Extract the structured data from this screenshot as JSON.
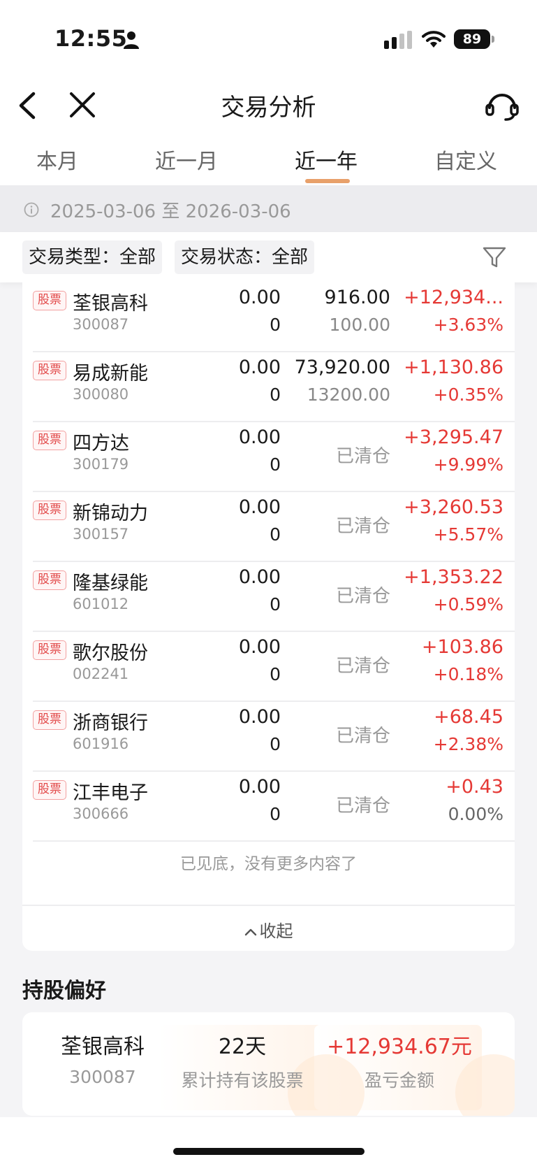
{
  "status_bar": {
    "time": "12:55",
    "battery": "89"
  },
  "nav": {
    "title": "交易分析"
  },
  "tabs": [
    {
      "label": "本月"
    },
    {
      "label": "近一月"
    },
    {
      "label": "近一年"
    },
    {
      "label": "自定义"
    }
  ],
  "active_tab": 2,
  "date_range": "2025-03-06 至 2026-03-06",
  "filters": {
    "type": "交易类型：全部",
    "status": "交易状态：全部"
  },
  "badge_label": "股票",
  "stocks": [
    {
      "name": "荃银高科",
      "code": "300087",
      "a1": "0.00",
      "a2": "0",
      "b1": "916.00",
      "b2": "100.00",
      "c1": "+12,934...",
      "c2": "+3.63%"
    },
    {
      "name": "易成新能",
      "code": "300080",
      "a1": "0.00",
      "a2": "0",
      "b1": "73,920.00",
      "b2": "13200.00",
      "c1": "+1,130.86",
      "c2": "+0.35%"
    },
    {
      "name": "四方达",
      "code": "300179",
      "a1": "0.00",
      "a2": "0",
      "cleared": "已清仓",
      "c1": "+3,295.47",
      "c2": "+9.99%"
    },
    {
      "name": "新锦动力",
      "code": "300157",
      "a1": "0.00",
      "a2": "0",
      "cleared": "已清仓",
      "c1": "+3,260.53",
      "c2": "+5.57%"
    },
    {
      "name": "隆基绿能",
      "code": "601012",
      "a1": "0.00",
      "a2": "0",
      "cleared": "已清仓",
      "c1": "+1,353.22",
      "c2": "+0.59%"
    },
    {
      "name": "歌尔股份",
      "code": "002241",
      "a1": "0.00",
      "a2": "0",
      "cleared": "已清仓",
      "c1": "+103.86",
      "c2": "+0.18%"
    },
    {
      "name": "浙商银行",
      "code": "601916",
      "a1": "0.00",
      "a2": "0",
      "cleared": "已清仓",
      "c1": "+68.45",
      "c2": "+2.38%"
    },
    {
      "name": "江丰电子",
      "code": "300666",
      "a1": "0.00",
      "a2": "0",
      "cleared": "已清仓",
      "c1": "+0.43",
      "c2": "0.00%"
    }
  ],
  "list_end_note": "已见底，没有更多内容了",
  "collapse_label": "收起",
  "holding_pref": {
    "title": "持股偏好",
    "stock_name": "荃银高科",
    "stock_code": "300087",
    "days": "22天",
    "days_label": "累计持有该股票",
    "pnl": "+12,934.67元",
    "pnl_label": "盈亏金额"
  },
  "colors": {
    "accent": "#e8a06a",
    "gain": "#e53935",
    "badge": "#e24a4a"
  }
}
